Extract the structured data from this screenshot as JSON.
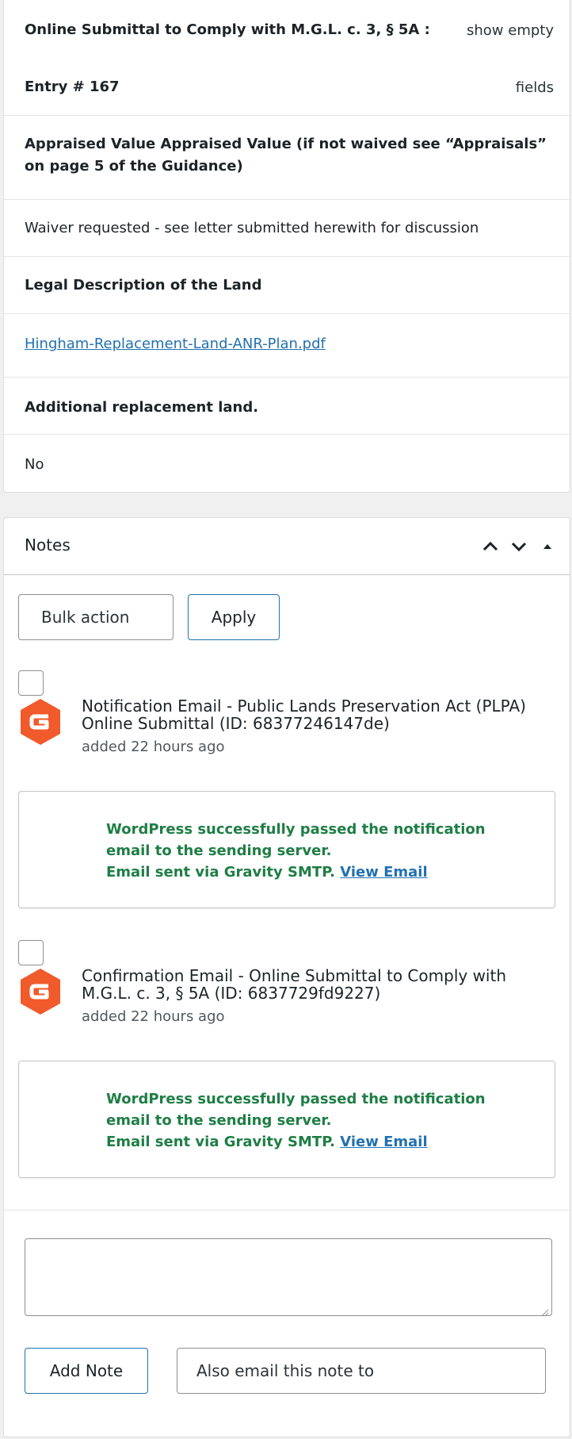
{
  "entry": {
    "header_title": "Online Submittal to Comply with M.G.L. c. 3, § 5A :",
    "entry_number": "Entry # 167",
    "show_empty_line1": "show empty",
    "show_empty_line2": "fields",
    "fields": [
      {
        "label": "Appraised Value Appraised Value (if not waived see “Appraisals” on page 5 of the Guidance)",
        "value": "Waiver requested - see letter submitted herewith for discussion"
      },
      {
        "label": "Legal Description of the Land",
        "value": "Hingham-Replacement-Land-ANR-Plan.pdf"
      },
      {
        "label": "Additional replacement land.",
        "value": "No"
      }
    ]
  },
  "notes": {
    "title": "Notes",
    "bulk_action_label": "Bulk action",
    "apply_label": "Apply",
    "items": [
      {
        "title": "Notification Email - Public Lands Preservation Act (PLPA) Online Submittal (ID: 68377246147de)",
        "meta": "added 22 hours ago",
        "message_line1": "WordPress successfully passed the notification email to the sending server.",
        "message_line2": "Email sent via Gravity SMTP.",
        "link_label": "View Email"
      },
      {
        "title": "Confirmation Email - Online Submittal to Comply with M.G.L. c. 3, § 5A (ID: 6837729fd9227)",
        "meta": "added 22 hours ago",
        "message_line1": "WordPress successfully passed the notification email to the sending server.",
        "message_line2": "Email sent via Gravity SMTP.",
        "link_label": "View Email"
      }
    ],
    "add_note_label": "Add Note",
    "email_placeholder": "Also email this note to"
  },
  "colors": {
    "brand_logo": "#f15a2b",
    "success_text": "#1e7e45",
    "link": "#2271b1"
  },
  "icons": {
    "header_controls": [
      "chevron-up-icon",
      "chevron-down-icon",
      "caret-up-icon"
    ],
    "note_author": "gravity-forms-logo-icon"
  }
}
